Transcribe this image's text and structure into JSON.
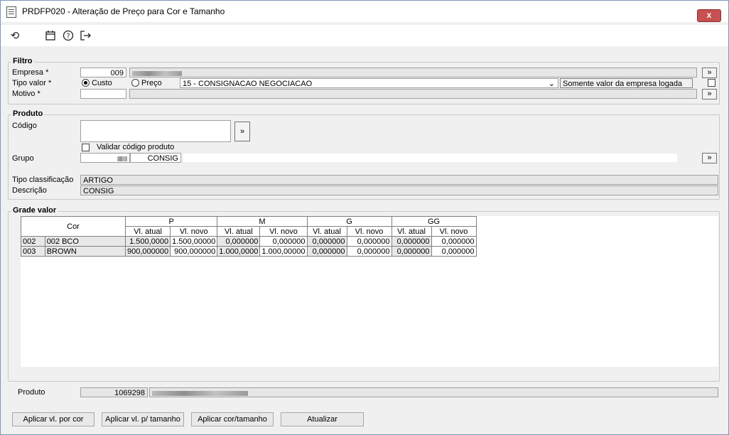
{
  "window": {
    "title": "PRDFP020 - Alteração de Preço para Cor e Tamanho",
    "close_label": "x"
  },
  "toolbar": {
    "icons": [
      "undo-icon",
      "calendar-icon",
      "help-icon",
      "exit-icon"
    ]
  },
  "filtro": {
    "title": "Filtro",
    "empresa_label": "Empresa *",
    "empresa_code": "009",
    "tipo_valor_label": "Tipo valor *",
    "custo_label": "Custo",
    "preco_label": "Preço",
    "tipo_valor_selected": "Custo",
    "preco_select_value": "15 - CONSIGNACAO NEGOCIACAO",
    "somente_label": "Somente valor da empresa logada",
    "motivo_label": "Motivo *",
    "motivo_value": "",
    "lookup_button": "»"
  },
  "produto": {
    "title": "Produto",
    "codigo_label": "Código",
    "codigo_value": "",
    "validar_label": "Validar código produto",
    "grupo_label": "Grupo",
    "grupo_value": "CONSIG",
    "tipo_classificacao_label": "Tipo classificação",
    "tipo_classificacao_value": "ARTIGO",
    "descricao_label": "Descrição",
    "descricao_value": "CONSIG",
    "lookup_button": "»"
  },
  "grade": {
    "title": "Grade valor",
    "cor_header": "Cor",
    "sizes": [
      "P",
      "M",
      "G",
      "GG"
    ],
    "sub_headers": [
      "Vl. atual",
      "Vl. novo"
    ],
    "rows": [
      {
        "code": "002",
        "cor": "002 BCO",
        "values": [
          "1.500,0000",
          "1.500,00000",
          "0,000000",
          "0,000000",
          "0,000000",
          "0,000000",
          "0,000000",
          "0,000000"
        ]
      },
      {
        "code": "003",
        "cor": "BROWN",
        "values": [
          "900,000000",
          "900,000000",
          "1.000,0000",
          "1.000,00000",
          "0,000000",
          "0,000000",
          "0,000000",
          "0,000000"
        ]
      }
    ]
  },
  "footer": {
    "produto_label": "Produto",
    "produto_code": "1069298",
    "buttons": {
      "aplicar_cor": "Aplicar vl. por cor",
      "aplicar_tamanho": "Aplicar vl. p/ tamanho",
      "aplicar_cor_tamanho": "Aplicar cor/tamanho",
      "atualizar": "Atualizar"
    }
  }
}
